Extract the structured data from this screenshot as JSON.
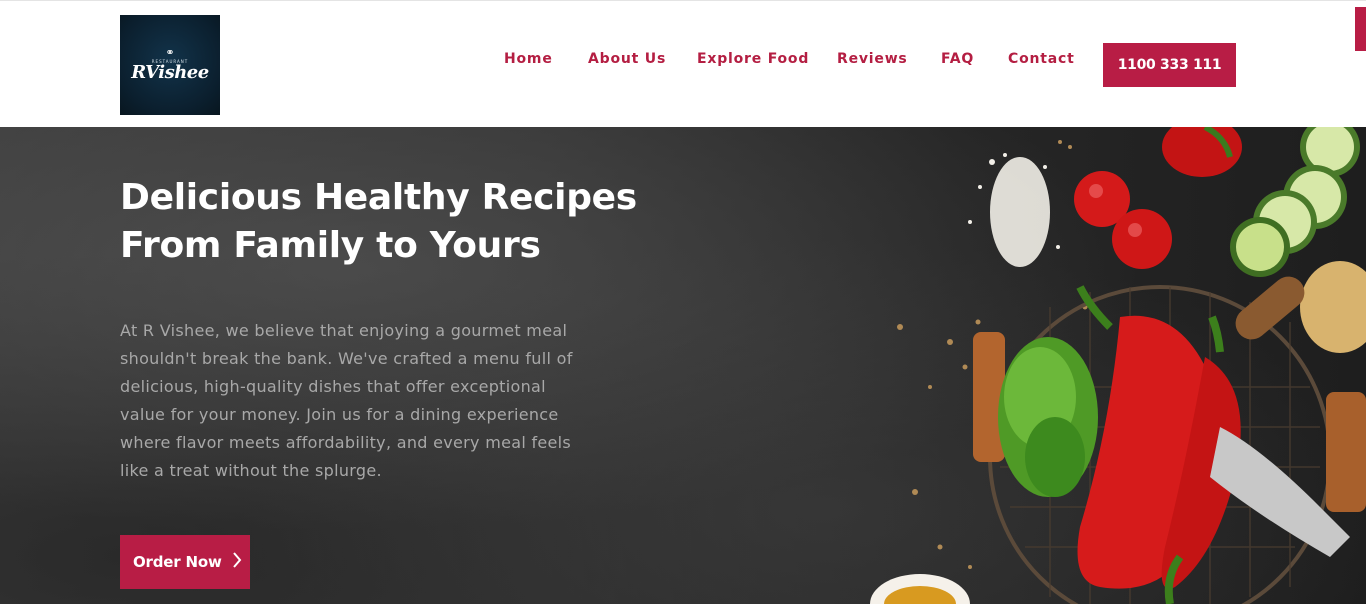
{
  "logo": {
    "small_text": "RESTAURANT",
    "script_text": "RVishee",
    "hat_icon": "chef-hat-icon"
  },
  "nav": {
    "items": [
      {
        "label": "Home"
      },
      {
        "label": "About Us"
      },
      {
        "label": "Explore Food"
      },
      {
        "label": "Reviews"
      },
      {
        "label": "FAQ"
      },
      {
        "label": "Contact"
      }
    ],
    "phone": "1100 333 111"
  },
  "hero": {
    "title_line1": "Delicious Healthy Recipes",
    "title_line2": "From Family to Yours",
    "description": "At R Vishee, we believe that enjoying a gourmet meal shouldn't break the bank. We've crafted a menu full of delicious, high-quality dishes that offer exceptional value for your money. Join us for a dining experience where flavor meets affordability, and every meal feels like a treat without the splurge.",
    "cta_label": "Order Now",
    "cta_icon": "chevron-right-icon"
  },
  "colors": {
    "accent": "#b81d45",
    "nav_text": "#b41e42",
    "hero_bg": "#2e2e2e",
    "body_text": "#a8a8a8"
  }
}
